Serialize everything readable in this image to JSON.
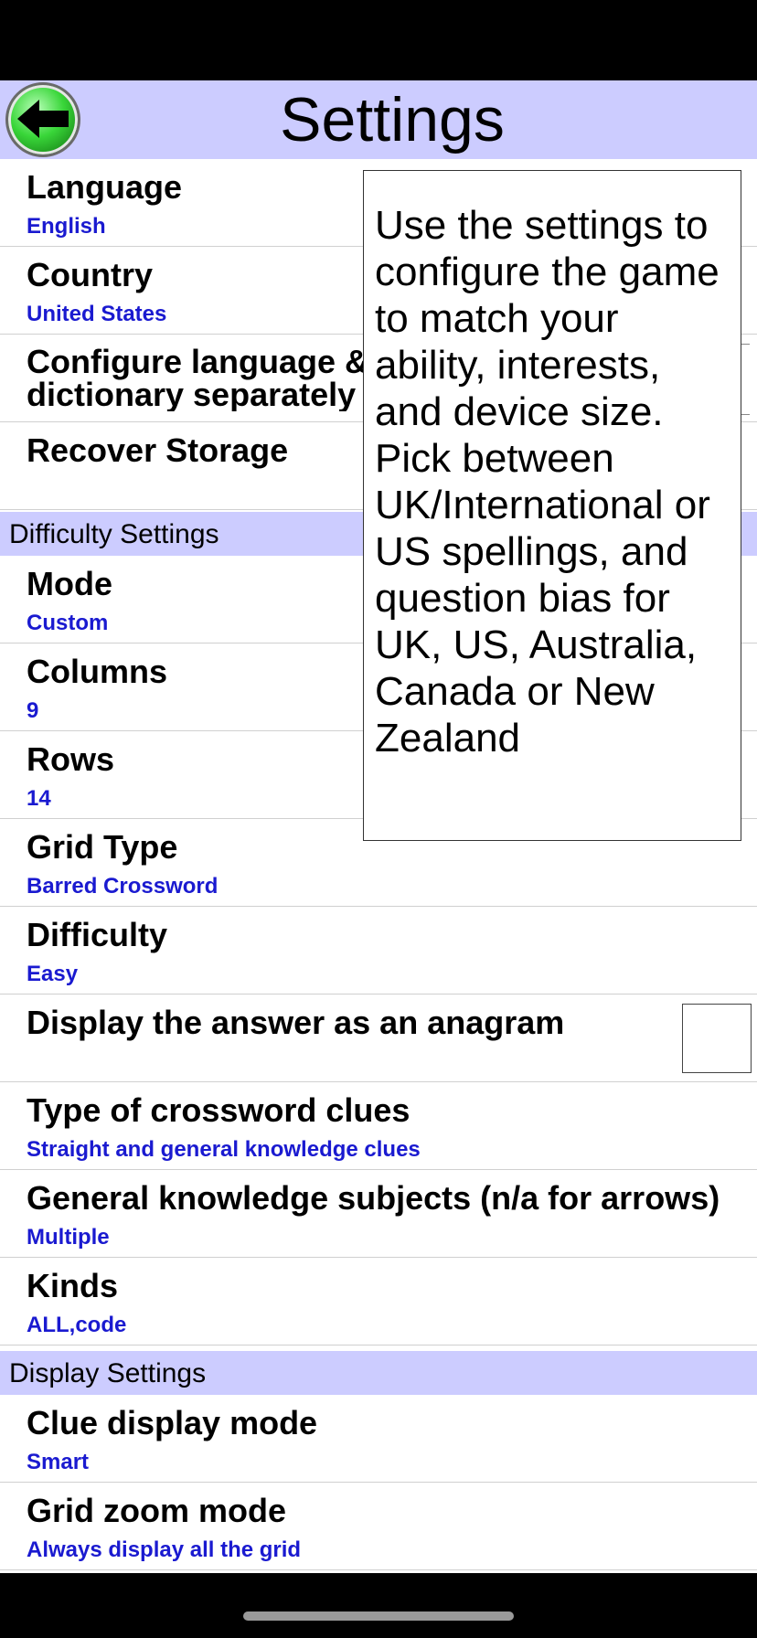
{
  "header": {
    "title": "Settings",
    "back_icon": "back-arrow-icon"
  },
  "rows": [
    {
      "title": "Language",
      "value": "English"
    },
    {
      "title": "Country",
      "value": "United States"
    },
    {
      "title": "Configure language & dictionary separately",
      "value": ""
    },
    {
      "title": "Recover Storage",
      "value": ""
    }
  ],
  "difficulty_section": {
    "label": "Difficulty Settings",
    "mode": {
      "title": "Mode",
      "value": "Custom"
    },
    "columns": {
      "title": "Columns",
      "value": "9"
    },
    "rows": {
      "title": "Rows",
      "value": "14"
    },
    "grid_type": {
      "title": "Grid Type",
      "value": "Barred Crossword"
    },
    "difficulty": {
      "title": "Difficulty",
      "value": "Easy"
    },
    "anagram": {
      "title": "Display the answer as an anagram",
      "checked": false
    },
    "clue_type": {
      "title": "Type of crossword clues",
      "value": "Straight and general knowledge clues"
    },
    "gk_subjects": {
      "title": "General knowledge subjects (n/a for arrows)",
      "value": "Multiple"
    },
    "kinds": {
      "title": "Kinds",
      "value": "ALL,code"
    }
  },
  "display_section": {
    "label": "Display Settings",
    "clue_display": {
      "title": "Clue display mode",
      "value": "Smart"
    },
    "grid_zoom": {
      "title": "Grid zoom mode",
      "value": "Always display all the grid"
    }
  },
  "tooltip": {
    "text": "Use the settings to configure the game to match your ability, interests, and device size. Pick between UK/International or US spellings, and question bias for UK, US, Australia, Canada or New Zealand"
  },
  "colors": {
    "header_bg": "#ccccff",
    "value_text": "#1a1ad0",
    "back_button": "#39d639"
  }
}
